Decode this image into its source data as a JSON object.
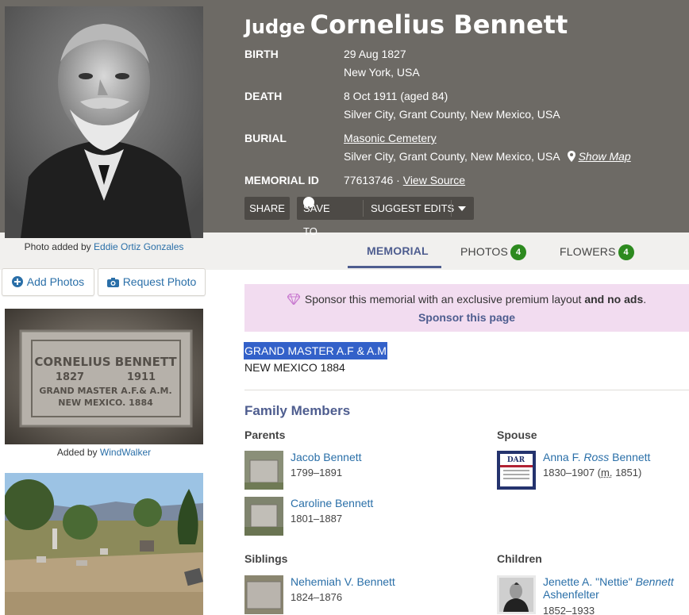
{
  "memorial": {
    "name_prefix": "Judge",
    "name": "Cornelius Bennett",
    "facts": {
      "birth_label": "BIRTH",
      "birth_date": "29 Aug 1827",
      "birth_place": "New York, USA",
      "death_label": "DEATH",
      "death_date": "8 Oct 1911 (aged 84)",
      "death_place": "Silver City, Grant County, New Mexico, USA",
      "burial_label": "BURIAL",
      "burial_cemetery": "Masonic Cemetery",
      "burial_place": "Silver City, Grant County, New Mexico, USA",
      "show_map": "Show Map",
      "memorial_id_label": "MEMORIAL ID",
      "memorial_id": "77613746 ·",
      "view_source": "View Source"
    },
    "actions": {
      "share": "SHARE",
      "save_to": "SAVE TO",
      "suggest_edits": "SUGGEST EDITS"
    }
  },
  "profile_photo": {
    "credit_prefix": "Photo added by",
    "credit_name": "Eddie Ortiz Gonzales"
  },
  "tabs": [
    {
      "label": "MEMORIAL",
      "active": true
    },
    {
      "label": "PHOTOS",
      "count": "4"
    },
    {
      "label": "FLOWERS",
      "count": "4"
    }
  ],
  "left_buttons": {
    "add_photos": "Add Photos",
    "request_photo": "Request Photo"
  },
  "gallery": [
    {
      "headstone_lines": [
        "CORNELIUS BENNETT",
        "1827",
        "1911",
        "GRAND MASTER A.F.& A.M.",
        "NEW MEXICO. 1884"
      ],
      "credit_prefix": "Added by",
      "credit_name": "WindWalker"
    },
    {
      "credit_prefix": "",
      "credit_name": ""
    }
  ],
  "sponsor": {
    "text": "Sponsor this memorial with an exclusive premium layout",
    "bold": "and no ads",
    "period": ".",
    "link": "Sponsor this page"
  },
  "inscription": {
    "line1": "GRAND MASTER A.F & A.M",
    "line2": "NEW MEXICO 1884"
  },
  "family": {
    "title": "Family Members",
    "parents_label": "Parents",
    "spouse_label": "Spouse",
    "siblings_label": "Siblings",
    "children_label": "Children",
    "parents": [
      {
        "name": "Jacob Bennett",
        "dates": "1799–1891"
      },
      {
        "name": "Caroline Bennett",
        "dates": "1801–1887"
      }
    ],
    "spouse": {
      "first": "Anna F.",
      "maiden": "Ross",
      "last": "Bennett",
      "dates": "1830–1907 (",
      "married_abbr": "m.",
      "married_year": " 1851)",
      "badge": "DAR"
    },
    "siblings": [
      {
        "name": "Nehemiah V. Bennett",
        "dates": "1824–1876"
      }
    ],
    "children": [
      {
        "first": "Jenette A. \"Nettie\"",
        "maiden": "Bennett",
        "last": "Ashenfelter",
        "dates": "1852–1933"
      }
    ]
  },
  "colors": {
    "header_bg": "#6d6a65",
    "accent": "#4e5d8f",
    "link": "#2a6fa8",
    "badge_green": "#2d8a1f",
    "sponsor_bg": "#f2dcf0",
    "highlight": "#3361c9"
  }
}
